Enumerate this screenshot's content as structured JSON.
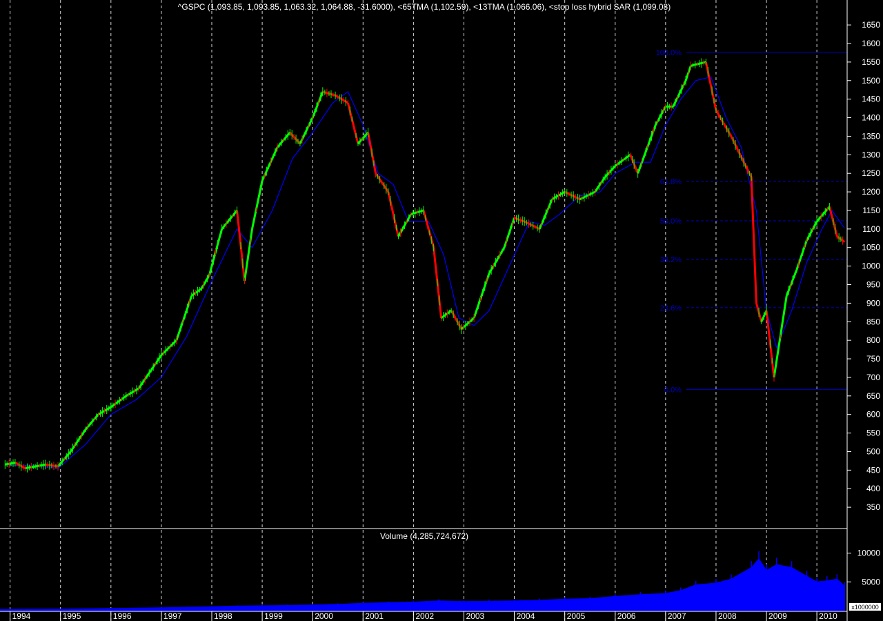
{
  "colors": {
    "background": "#000000",
    "grid": "#ffffff",
    "price_up": "#00ff00",
    "price_down": "#ff0000",
    "ma": "#0000ff",
    "fib": "#0000cc",
    "volume": "#0000ff",
    "text": "#ffffff"
  },
  "chart_data": [
    {
      "type": "line",
      "title": "^GSPC (1,093.85, 1,093.85, 1,063.32, 1,064.88, -31.6000), <65TMA (1,102.59), <13TMA (1,066.06), <stop loss hybrid SAR (1,099.08)",
      "series": [
        {
          "name": "^GSPC",
          "x": [
            1993.9,
            1994.1,
            1994.3,
            1994.5,
            1994.7,
            1994.95,
            1995.2,
            1995.5,
            1995.75,
            1996.0,
            1996.3,
            1996.55,
            1996.8,
            1997.0,
            1997.3,
            1997.6,
            1997.8,
            1997.95,
            1998.2,
            1998.5,
            1998.65,
            1998.8,
            1999.0,
            1999.3,
            1999.55,
            1999.75,
            2000.0,
            2000.2,
            2000.45,
            2000.7,
            2000.9,
            2001.1,
            2001.25,
            2001.5,
            2001.7,
            2001.95,
            2002.2,
            2002.4,
            2002.55,
            2002.75,
            2002.95,
            2003.2,
            2003.5,
            2003.8,
            2004.0,
            2004.2,
            2004.5,
            2004.75,
            2005.0,
            2005.3,
            2005.6,
            2005.8,
            2006.0,
            2006.3,
            2006.45,
            2006.8,
            2007.0,
            2007.15,
            2007.4,
            2007.5,
            2007.8,
            2008.0,
            2008.3,
            2008.55,
            2008.7,
            2008.8,
            2008.9,
            2009.0,
            2009.15,
            2009.4,
            2009.6,
            2009.8,
            2010.0,
            2010.25,
            2010.4,
            2010.55
          ],
          "values": [
            465,
            470,
            455,
            460,
            465,
            460,
            500,
            560,
            600,
            620,
            650,
            670,
            720,
            760,
            800,
            920,
            940,
            975,
            1100,
            1150,
            960,
            1100,
            1230,
            1320,
            1360,
            1330,
            1400,
            1470,
            1460,
            1440,
            1330,
            1360,
            1250,
            1200,
            1080,
            1140,
            1150,
            1050,
            860,
            880,
            830,
            860,
            980,
            1050,
            1130,
            1120,
            1100,
            1180,
            1200,
            1180,
            1200,
            1240,
            1270,
            1300,
            1250,
            1380,
            1430,
            1430,
            1500,
            1540,
            1550,
            1420,
            1350,
            1280,
            1240,
            900,
            850,
            880,
            700,
            920,
            990,
            1070,
            1120,
            1160,
            1080,
            1065
          ]
        },
        {
          "name": "<65TMA",
          "x": [
            1994.0,
            1994.5,
            1994.95,
            1995.5,
            1996.0,
            1996.5,
            1997.0,
            1997.5,
            1998.0,
            1998.5,
            1998.8,
            1999.2,
            1999.6,
            2000.0,
            2000.4,
            2000.7,
            2001.0,
            2001.3,
            2001.6,
            2001.9,
            2002.3,
            2002.6,
            2002.9,
            2003.2,
            2003.5,
            2003.9,
            2004.3,
            2004.6,
            2004.9,
            2005.3,
            2005.7,
            2006.0,
            2006.4,
            2006.7,
            2007.0,
            2007.3,
            2007.6,
            2007.9,
            2008.2,
            2008.5,
            2008.8,
            2009.0,
            2009.2,
            2009.5,
            2009.8,
            2010.1,
            2010.3,
            2010.55
          ],
          "values": [
            462,
            462,
            455,
            520,
            600,
            640,
            700,
            810,
            960,
            1100,
            1050,
            1150,
            1290,
            1360,
            1440,
            1470,
            1380,
            1250,
            1220,
            1120,
            1120,
            1030,
            860,
            840,
            880,
            1000,
            1120,
            1110,
            1140,
            1190,
            1200,
            1250,
            1280,
            1280,
            1380,
            1450,
            1500,
            1510,
            1400,
            1320,
            1150,
            880,
            780,
            880,
            1010,
            1100,
            1150,
            1102
          ]
        }
      ],
      "fibonacci": [
        {
          "label": "100.0%",
          "value": 1576
        },
        {
          "label": "61.8%",
          "value": 1228
        },
        {
          "label": "50.0%",
          "value": 1122
        },
        {
          "label": "38.2%",
          "value": 1018
        },
        {
          "label": "23.6%",
          "value": 888
        },
        {
          "label": "0.0%",
          "value": 667
        }
      ],
      "yticks": [
        350,
        400,
        450,
        500,
        550,
        600,
        650,
        700,
        750,
        800,
        850,
        900,
        950,
        1000,
        1050,
        1100,
        1150,
        1200,
        1250,
        1300,
        1350,
        1400,
        1450,
        1500,
        1550,
        1600,
        1650
      ],
      "ylim": [
        300,
        1680
      ],
      "xlim": [
        1993.8,
        2010.6
      ],
      "grid": "vertical dashed at year boundaries"
    },
    {
      "type": "area",
      "title": "Volume (4,285,724,672)",
      "unit_label": "x1000000",
      "yticks": [
        5000,
        10000
      ],
      "ylim": [
        0,
        12000
      ],
      "x": [
        1993.8,
        1994.5,
        1995.0,
        1995.5,
        1996.0,
        1996.5,
        1997.0,
        1997.5,
        1998.0,
        1998.5,
        1999.0,
        1999.5,
        2000.0,
        2000.5,
        2001.0,
        2001.5,
        2002.0,
        2002.5,
        2003.0,
        2003.5,
        2004.0,
        2004.5,
        2005.0,
        2005.5,
        2006.0,
        2006.5,
        2007.0,
        2007.3,
        2007.6,
        2008.0,
        2008.3,
        2008.7,
        2008.85,
        2009.0,
        2009.2,
        2009.5,
        2009.8,
        2010.0,
        2010.2,
        2010.4,
        2010.55
      ],
      "values": [
        200,
        250,
        280,
        320,
        400,
        450,
        500,
        600,
        700,
        800,
        850,
        900,
        1000,
        1100,
        1300,
        1400,
        1500,
        1700,
        1600,
        1650,
        1700,
        1800,
        2000,
        2100,
        2500,
        2800,
        3000,
        3500,
        4500,
        4800,
        5500,
        7500,
        9000,
        7000,
        8000,
        7500,
        6000,
        5000,
        5200,
        5500,
        4300
      ]
    }
  ],
  "x_axis": {
    "year_labels": [
      "1994",
      "1995",
      "1996",
      "1997",
      "1998",
      "1999",
      "2000",
      "2001",
      "2002",
      "2003",
      "2004",
      "2005",
      "2006",
      "2007",
      "2008",
      "2009",
      "2010"
    ]
  }
}
